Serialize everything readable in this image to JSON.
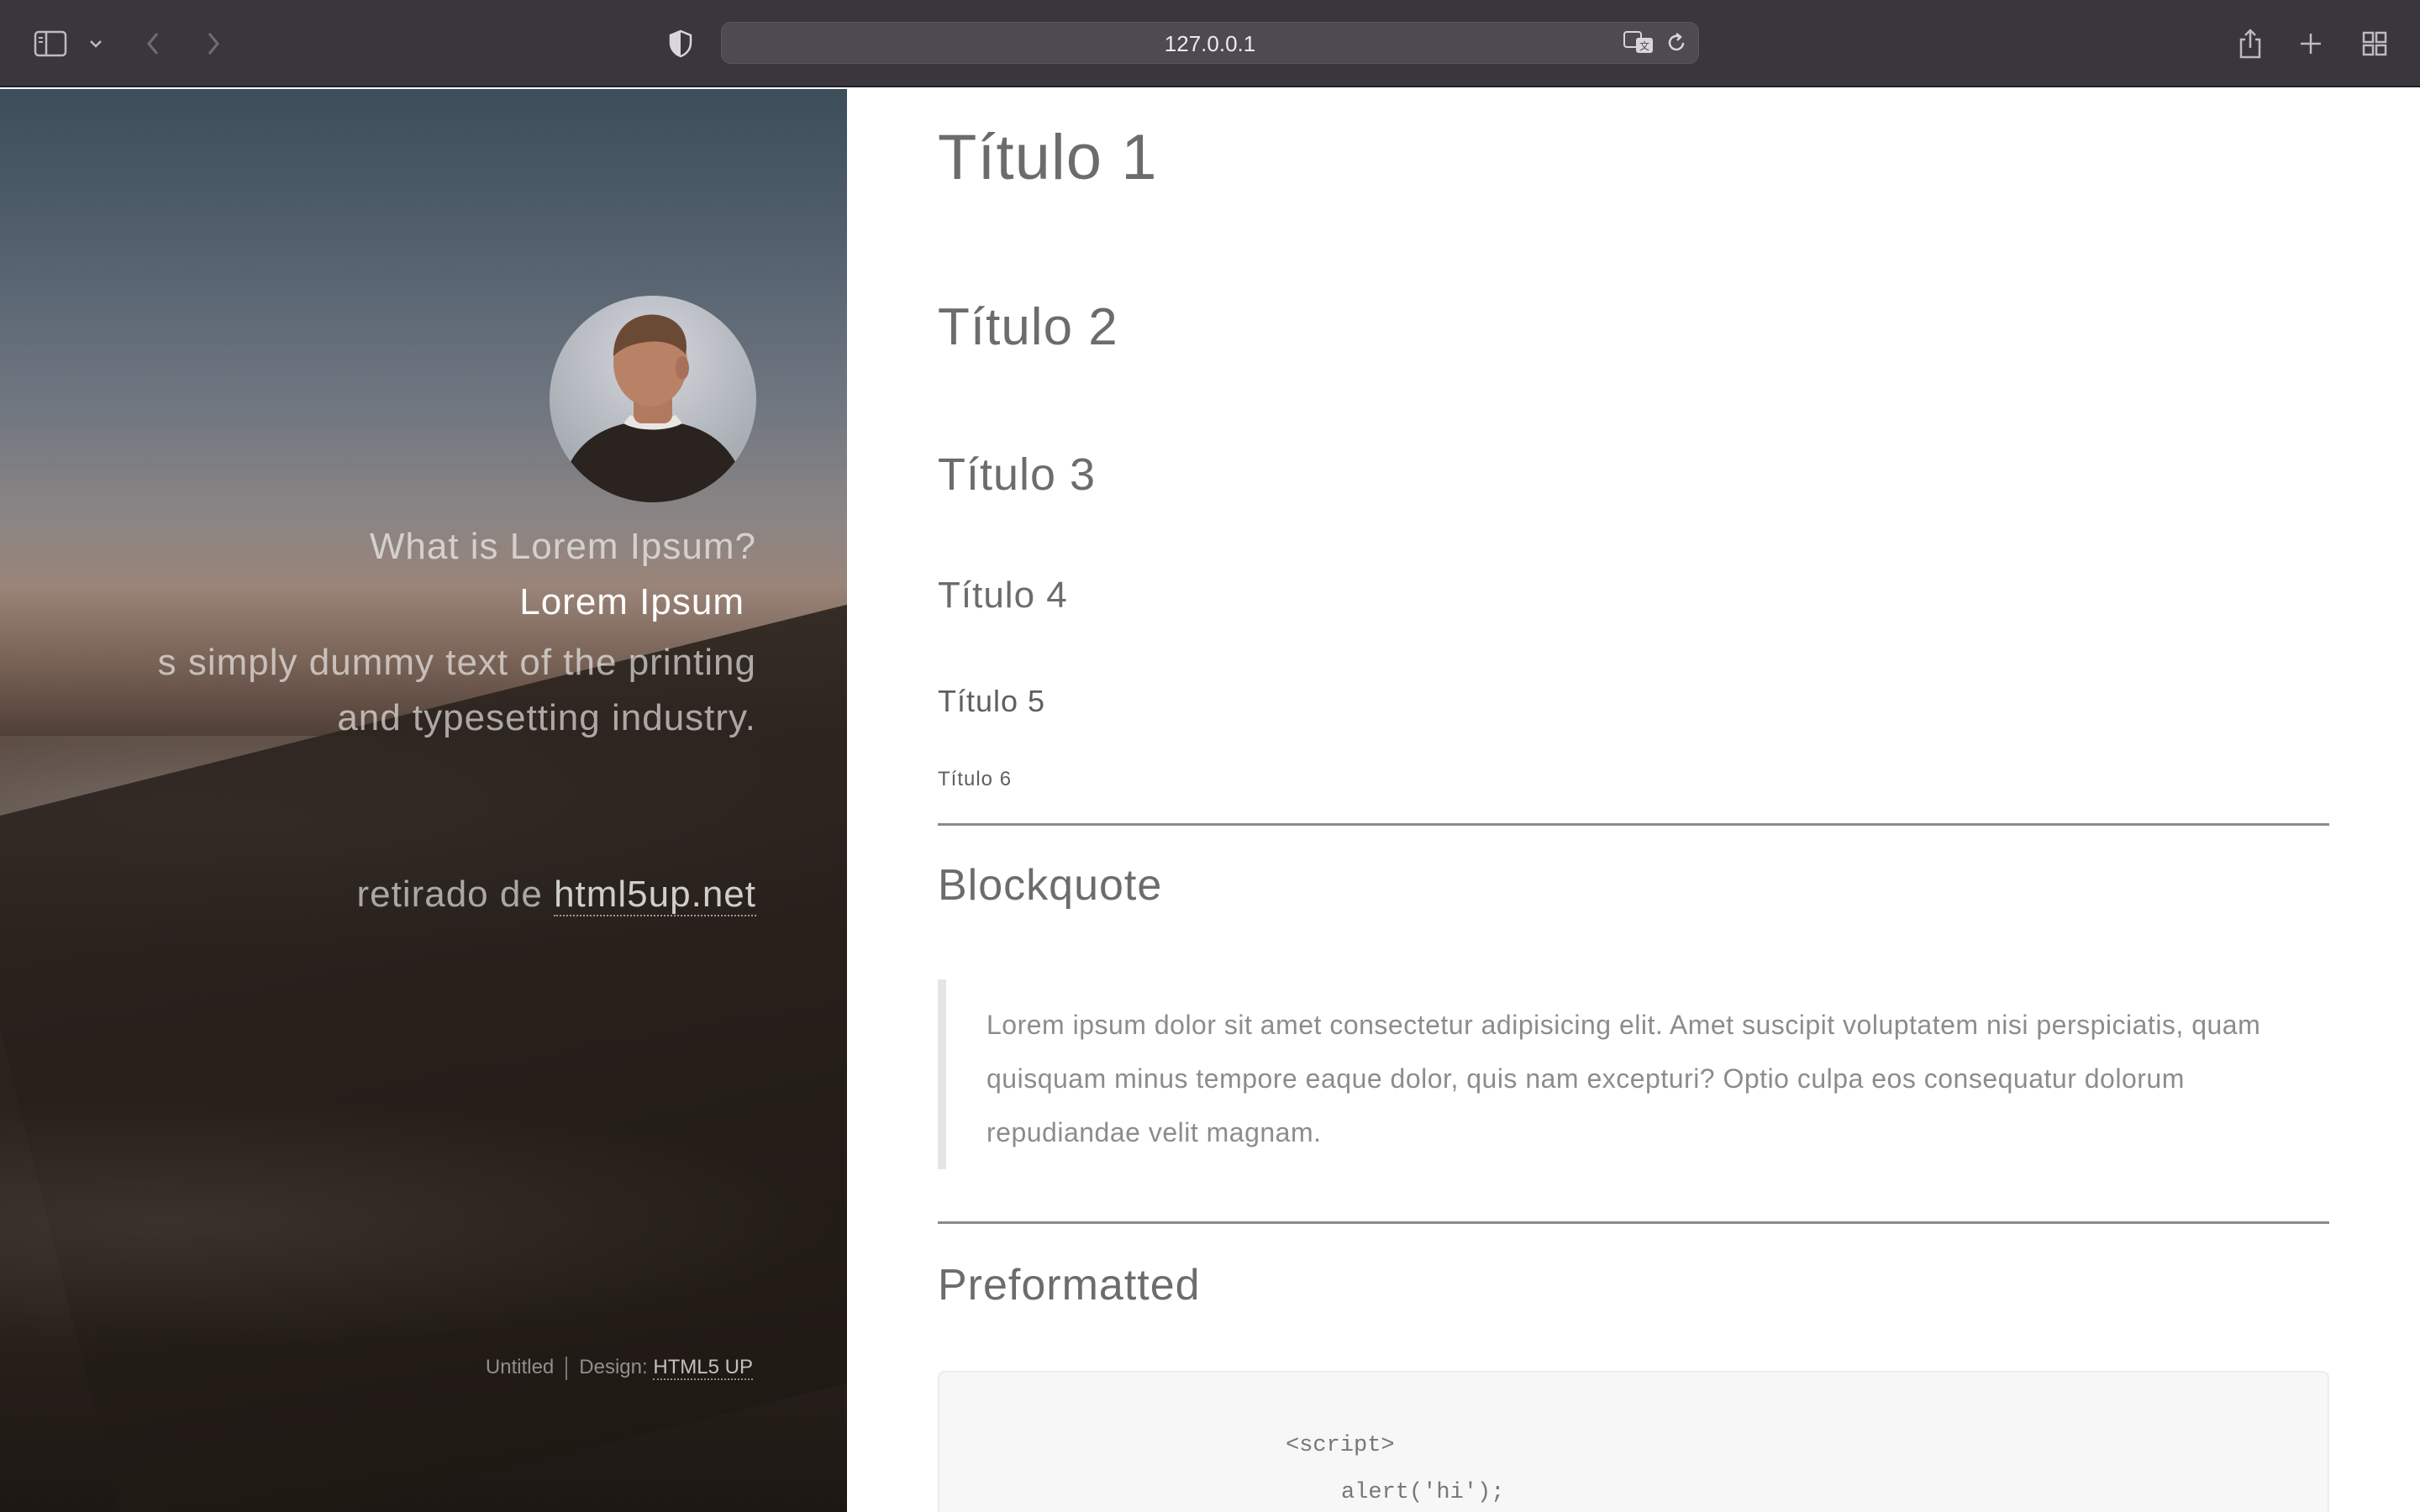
{
  "browser": {
    "url": "127.0.0.1",
    "icons": [
      "sidebar-icon",
      "chevron-down-icon",
      "back-icon",
      "forward-icon",
      "shield-icon",
      "translate-icon",
      "reload-icon",
      "share-icon",
      "new-tab-icon",
      "tab-overview-icon"
    ]
  },
  "sidebar": {
    "question": "What is Lorem Ipsum?",
    "name": "Lorem Ipsum",
    "description_line1": "s simply dummy text of the printing",
    "description_line2": "and typesetting industry.",
    "credit_prefix": "retirado de",
    "credit_link": "html5up.net",
    "footer_untitled": "Untitled",
    "footer_design_label": "Design:",
    "footer_design_link": "HTML5 UP"
  },
  "main": {
    "headings": {
      "h1": "Título 1",
      "h2": "Título 2",
      "h3": "Título 3",
      "h4": "Título 4",
      "h5": "Título 5",
      "h6": "Título 6"
    },
    "blockquote_title": "Blockquote",
    "blockquote_text": "Lorem ipsum dolor sit amet consectetur adipisicing elit. Amet suscipit voluptatem nisi perspiciatis, quam quisquam minus tempore eaque dolor, quis nam excepturi? Optio culpa eos consequatur dolorum repudiandae velit magnam.",
    "preformatted_title": "Preformatted",
    "code_line1": "<script>",
    "code_line2": "alert('hi');"
  }
}
